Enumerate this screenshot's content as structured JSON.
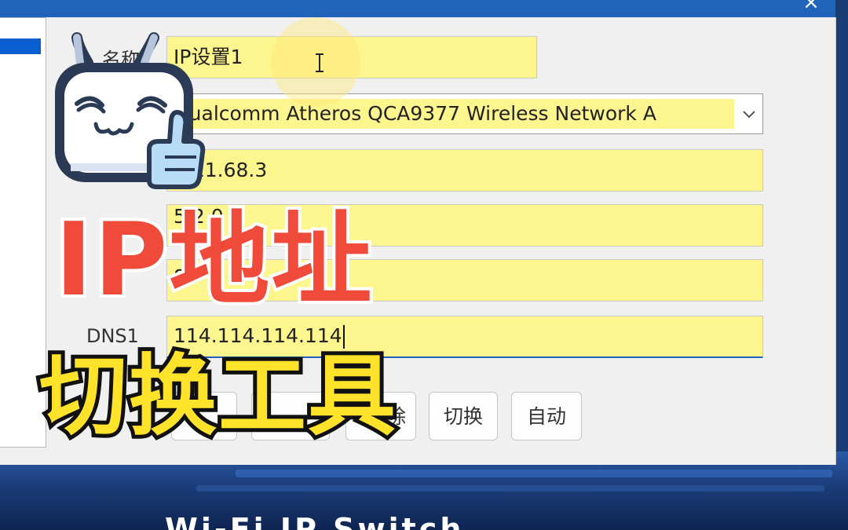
{
  "window": {
    "close_label": "×"
  },
  "form": {
    "name_label": "名称",
    "name_value": "IP设置1",
    "adapter_value": "Qualcomm Atheros QCA9377 Wireless Network A",
    "ip_value": ".211.68.3",
    "mask_value": "5.2 0",
    "gateway_value": "8",
    "dns1_label": "DNS1",
    "dns1_value": "114.114.114.114"
  },
  "buttons": {
    "delete_label": "除",
    "switch_label": "切换",
    "auto_label": "自动"
  },
  "overlay": {
    "headline": "IP地址",
    "subline": "切换工具",
    "bottom_caption": "Wi-Fi IP Switch"
  },
  "colors": {
    "field_yellow": "#fdf58e",
    "titlebar_blue": "#1f64b8",
    "headline_red": "#f04a3a",
    "subline_yellow": "#ffe22a"
  },
  "icons": {
    "mascot": "bilibili-tv-mascot-thumbs-up",
    "cursor": "text-ibeam-cursor",
    "dropdown": "chevron-down-icon"
  }
}
